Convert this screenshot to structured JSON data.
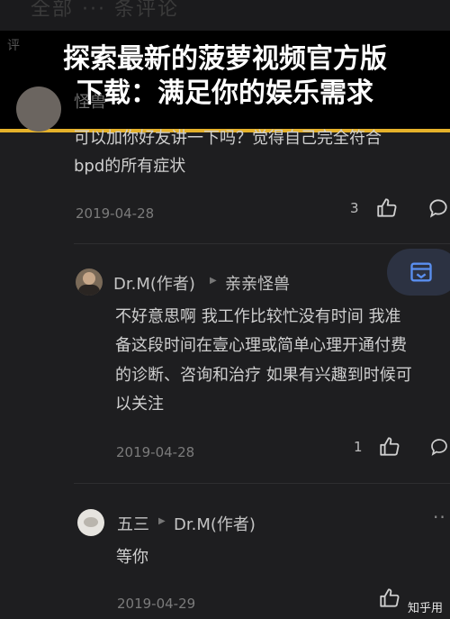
{
  "banner": {
    "line1": "探索最新的菠萝视频官方版",
    "line2": "下载：满足你的娱乐需求"
  },
  "top": {
    "faint_title": "全部 ··· 条评论",
    "tab_fragment": "评"
  },
  "comment1": {
    "name_partial": "怪兽",
    "text_line1": "可以加你好友讲一下吗？觉得自己完全符合",
    "text_line2": "bpd的所有症状",
    "date": "2019-04-28",
    "likes": "3"
  },
  "reply1": {
    "author": "Dr.M(作者)",
    "reply_to": "亲亲怪兽",
    "text_line1": "不好意思啊 我工作比较忙没有时间 我准",
    "text_line2": "备这段时间在壹心理或简单心理开通付费",
    "text_line3": "的诊断、咨询和治疗 如果有兴趣到时候可",
    "text_line4": "以关注",
    "date": "2019-04-28",
    "likes": "1"
  },
  "reply2": {
    "author": "五三",
    "reply_to": "Dr.M(作者)",
    "text": "等你",
    "date": "2019-04-29"
  },
  "watermark": "知乎用",
  "colors": {
    "background": "#1e1e20",
    "banner_bg": "#000000",
    "banner_border": "#e5b12a",
    "float_button_icon": "#5a8ff0"
  },
  "icons": {
    "like": "thumbs-up-icon",
    "comment": "speech-bubble-icon",
    "more": "more-dots-icon",
    "float": "calendar-inbox-icon"
  }
}
